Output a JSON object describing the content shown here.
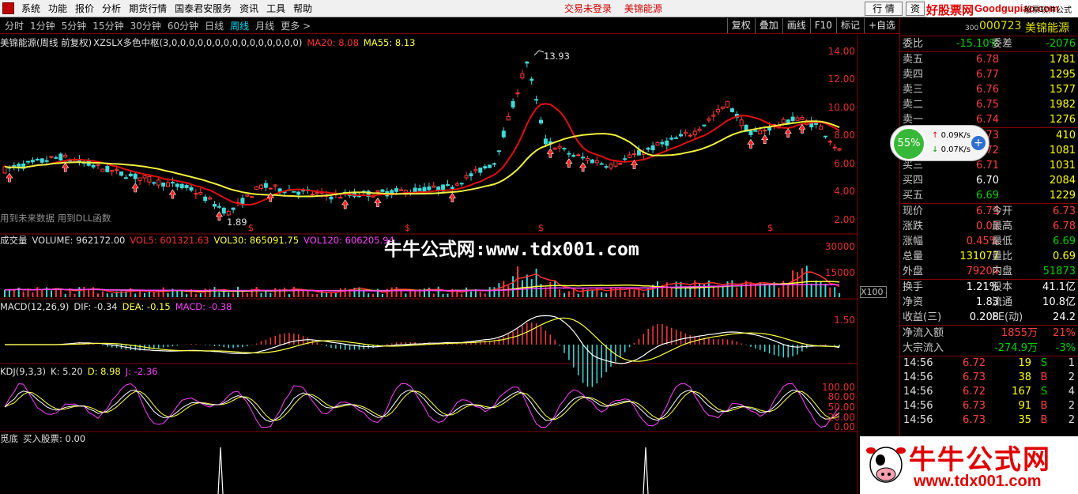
{
  "menubar": {
    "items": [
      "系统",
      "功能",
      "报价",
      "分析",
      "期货行情",
      "国泰君安服务",
      "资讯",
      "工具",
      "帮助"
    ],
    "status_login": "交易未登录",
    "status_stock": "美锦能源",
    "btn_quote": "行 情",
    "btn_trade": "资",
    "logo_cn": "好股票网",
    "logo_url": "Goodgupiao.com",
    "logo_tag": "股票软件公式"
  },
  "toolbar": {
    "periods": [
      "分时",
      "1分钟",
      "5分钟",
      "15分钟",
      "30分钟",
      "60分钟",
      "日线",
      "周线",
      "月线",
      "更多 >"
    ],
    "active_period": "周线",
    "right_tools": [
      "复权",
      "叠加",
      "画线",
      "F10",
      "标记",
      "+自选"
    ]
  },
  "main_chart": {
    "title": "美锦能源(周线 前复权)",
    "indicator": "XZSLX多色中枢(3,0,0,0,0,0,0,0,0,0,0,0,0,0,0,0)",
    "ma20": "MA20: 8.08",
    "ma55": "MA55: 8.13",
    "y_ticks": [
      "14.00",
      "12.00",
      "10.00",
      "8.00",
      "6.00",
      "4.00",
      "2.00"
    ],
    "high_label": "13.93",
    "low_label": "1.89",
    "note": "用到未来数据 用到DLL函数",
    "s_markers": [
      "$",
      "$",
      "$",
      "$"
    ]
  },
  "volume_panel": {
    "name": "成交量",
    "volume": "VOLUME: 962172.00",
    "vol5": "VOL5: 601321.63",
    "vol30": "VOL30: 865091.75",
    "vol120": "VOL120: 606205.94",
    "y_ticks": [
      "30000",
      "15000"
    ],
    "unit": "X100"
  },
  "macd_panel": {
    "name": "MACD(12,26,9)",
    "dif": "DIF: -0.34",
    "dea": "DEA: -0.15",
    "macd": "MACD: -0.38",
    "y_tick": "1.50"
  },
  "kdj_panel": {
    "name": "KDJ(9,3,3)",
    "k": "K: 5.20",
    "d": "D: 8.98",
    "j": "J: -2.36",
    "y_ticks": [
      "100.00",
      "80.00",
      "50.00",
      "20.00",
      "0.00"
    ]
  },
  "bottom_panel": {
    "name": "觅底",
    "value": "买入股票: 0.00"
  },
  "watermark": "牛牛公式网:www.tdx001.com",
  "promo": {
    "title": "牛牛公式网",
    "url": "www.tdx001.com"
  },
  "stock": {
    "code_prefix": "300",
    "code": "000723",
    "name": "美锦能源"
  },
  "order_book": {
    "weibi_label": "委比",
    "weibi": "-15.10%",
    "weicha_label": "委差",
    "weicha": "-2076",
    "asks": [
      {
        "label": "卖五",
        "price": "6.78",
        "vol": "1781"
      },
      {
        "label": "卖四",
        "price": "6.77",
        "vol": "1295"
      },
      {
        "label": "卖三",
        "price": "6.76",
        "vol": "1577"
      },
      {
        "label": "卖二",
        "price": "6.75",
        "vol": "1982"
      },
      {
        "label": "卖一",
        "price": "6.74",
        "vol": "1276"
      }
    ],
    "bids": [
      {
        "label": "买一",
        "price": "6.73",
        "vol": "410"
      },
      {
        "label": "买二",
        "price": "6.72",
        "vol": "1081"
      },
      {
        "label": "买三",
        "price": "6.71",
        "vol": "1031"
      },
      {
        "label": "买四",
        "price": "6.70",
        "vol": "2084"
      },
      {
        "label": "买五",
        "price": "6.69",
        "vol": "1229"
      }
    ]
  },
  "quote": [
    {
      "l1": "现价",
      "v1": "6.73",
      "c1": "red",
      "l2": "今开",
      "v2": "6.73",
      "c2": "red"
    },
    {
      "l1": "涨跌",
      "v1": "0.03",
      "c1": "red",
      "l2": "最高",
      "v2": "6.78",
      "c2": "red"
    },
    {
      "l1": "涨幅",
      "v1": "0.45%",
      "c1": "red",
      "l2": "最低",
      "v2": "6.69",
      "c2": "green"
    },
    {
      "l1": "总量",
      "v1": "131077",
      "c1": "yellow",
      "l2": "量比",
      "v2": "0.69",
      "c2": "yellow"
    },
    {
      "l1": "外盘",
      "v1": "79204",
      "c1": "red",
      "l2": "内盘",
      "v2": "51873",
      "c2": "green"
    }
  ],
  "finance": [
    {
      "l1": "换手",
      "v1": "1.21%",
      "l2": "股本",
      "v2": "41.1亿"
    },
    {
      "l1": "净资",
      "v1": "1.83",
      "l2": "流通",
      "v2": "10.8亿"
    },
    {
      "l1": "收益(三)",
      "v1": "0.208",
      "l2": "PE(动)",
      "v2": "24.2"
    }
  ],
  "flows": [
    {
      "label": "净流入额",
      "value": "1855万",
      "pct": "21%",
      "c": "red"
    },
    {
      "label": "大宗流入",
      "value": "-274.9万",
      "pct": "-3%",
      "c": "green"
    }
  ],
  "ticks": [
    {
      "time": "14:56",
      "price": "6.72",
      "vol": "19",
      "side": "S",
      "n": "1"
    },
    {
      "time": "14:56",
      "price": "6.73",
      "vol": "38",
      "side": "B",
      "n": "2"
    },
    {
      "time": "14:56",
      "price": "6.72",
      "vol": "167",
      "side": "S",
      "n": "4"
    },
    {
      "time": "14:56",
      "price": "6.73",
      "vol": "91",
      "side": "B",
      "n": "2"
    },
    {
      "time": "14:56",
      "price": "6.73",
      "vol": "35",
      "side": "B",
      "n": "2"
    }
  ],
  "speed": {
    "pct": "55%",
    "up": "0.09K/s",
    "down": "0.07K/s",
    "plus": "+"
  },
  "colors": {
    "up": "#ff4040",
    "down": "#00d0d0",
    "ma20": "#e01010",
    "ma55": "#f0f040",
    "accent_red": "#800000"
  }
}
